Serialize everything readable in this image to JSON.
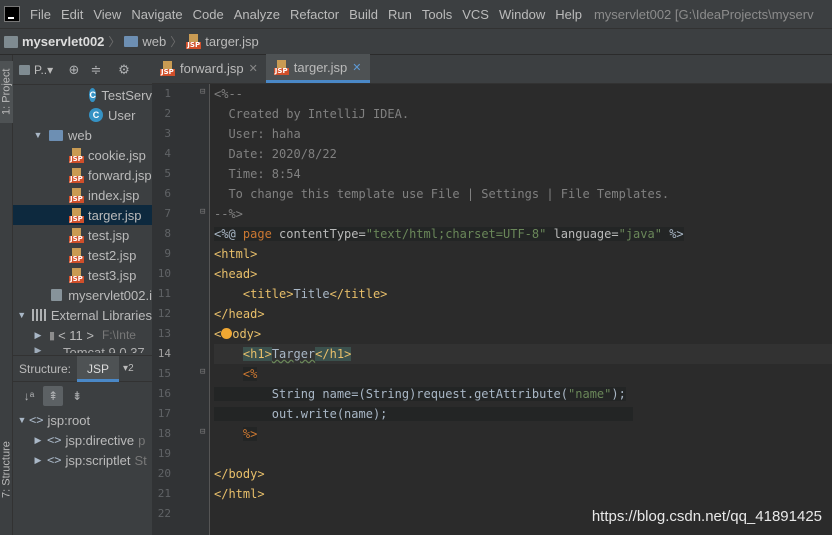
{
  "menu": {
    "items": [
      {
        "label": "File",
        "key": "F"
      },
      {
        "label": "Edit",
        "key": "E"
      },
      {
        "label": "View",
        "key": "V"
      },
      {
        "label": "Navigate",
        "key": "N"
      },
      {
        "label": "Code",
        "key": "C"
      },
      {
        "label": "Analyze",
        "key": "z"
      },
      {
        "label": "Refactor",
        "key": "R"
      },
      {
        "label": "Build",
        "key": "B"
      },
      {
        "label": "Run",
        "key": "u"
      },
      {
        "label": "Tools",
        "key": "T"
      },
      {
        "label": "VCS",
        "key": "S"
      },
      {
        "label": "Window",
        "key": "W"
      },
      {
        "label": "Help",
        "key": "H"
      }
    ],
    "window_title": "myservlet002 [G:\\IdeaProjects\\myserv"
  },
  "breadcrumb": {
    "project": "myservlet002",
    "folder": "web",
    "file": "targer.jsp"
  },
  "side_tabs": {
    "project": "1: Project",
    "structure": "7: Structure"
  },
  "project_panel": {
    "toolbar_label": "P..▾",
    "tree": [
      {
        "label": "TestServ",
        "type": "class"
      },
      {
        "label": "User",
        "type": "class"
      },
      {
        "label": "web",
        "type": "folder"
      },
      {
        "label": "cookie.jsp",
        "type": "jsp"
      },
      {
        "label": "forward.jsp",
        "type": "jsp"
      },
      {
        "label": "index.jsp",
        "type": "jsp"
      },
      {
        "label": "targer.jsp",
        "type": "jsp",
        "selected": true
      },
      {
        "label": "test.jsp",
        "type": "jsp"
      },
      {
        "label": "test2.jsp",
        "type": "jsp"
      },
      {
        "label": "test3.jsp",
        "type": "jsp"
      },
      {
        "label": "myservlet002.i",
        "type": "iml"
      },
      {
        "label": "External Libraries",
        "type": "lib"
      },
      {
        "label": "< 11 >",
        "type": "sdk",
        "hint": "F:\\Inte"
      },
      {
        "label": "Tomcat 9.0.37",
        "type": "server"
      }
    ]
  },
  "structure_panel": {
    "title": "Structure:",
    "tab": "JSP",
    "more": "▾2",
    "tree": [
      {
        "label": "jsp:root",
        "hint": ""
      },
      {
        "label": "jsp:directive",
        "hint": "p"
      },
      {
        "label": "jsp:scriptlet",
        "hint": "St"
      }
    ]
  },
  "tabs": [
    {
      "label": "forward.jsp",
      "active": false
    },
    {
      "label": "targer.jsp",
      "active": true
    }
  ],
  "editor": {
    "line_numbers": [
      "1",
      "2",
      "3",
      "4",
      "5",
      "6",
      "7",
      "8",
      "9",
      "10",
      "11",
      "12",
      "13",
      "14",
      "15",
      "16",
      "17",
      "18",
      "19",
      "20",
      "21",
      "22"
    ],
    "lines": {
      "l1": "<%--",
      "l2": "  Created by IntelliJ IDEA.",
      "l3": "  User: haha",
      "l4": "  Date: 2020/8/22",
      "l5": "  Time: 8:54",
      "l6": "  To change this template use File | Settings | File Templates.",
      "l7": "--%>",
      "l8_open": "<%@ ",
      "l8_page": "page",
      "l8_attr1": " contentType=",
      "l8_val1": "\"text/html;charset=UTF-8\"",
      "l8_attr2": " language=",
      "l8_val2": "\"java\"",
      "l8_close": " %>",
      "l9": "<html>",
      "l10": "<head>",
      "l11_open": "<title>",
      "l11_text": "Title",
      "l11_close": "</title>",
      "l12": "</head>",
      "l13_a": "<",
      "l13_b": "ody>",
      "l14_open": "<h1>",
      "l14_text": "Targer",
      "l14_close": "</h1>",
      "l15": "<%",
      "l16_a": "String name=(String)request.getAttribute(",
      "l16_str": "\"name\"",
      "l16_b": ");",
      "l17": "out.write(name);",
      "l18": "%>",
      "l20": "</body>",
      "l21": "</html>"
    }
  },
  "watermark": "https://blog.csdn.net/qq_41891425"
}
